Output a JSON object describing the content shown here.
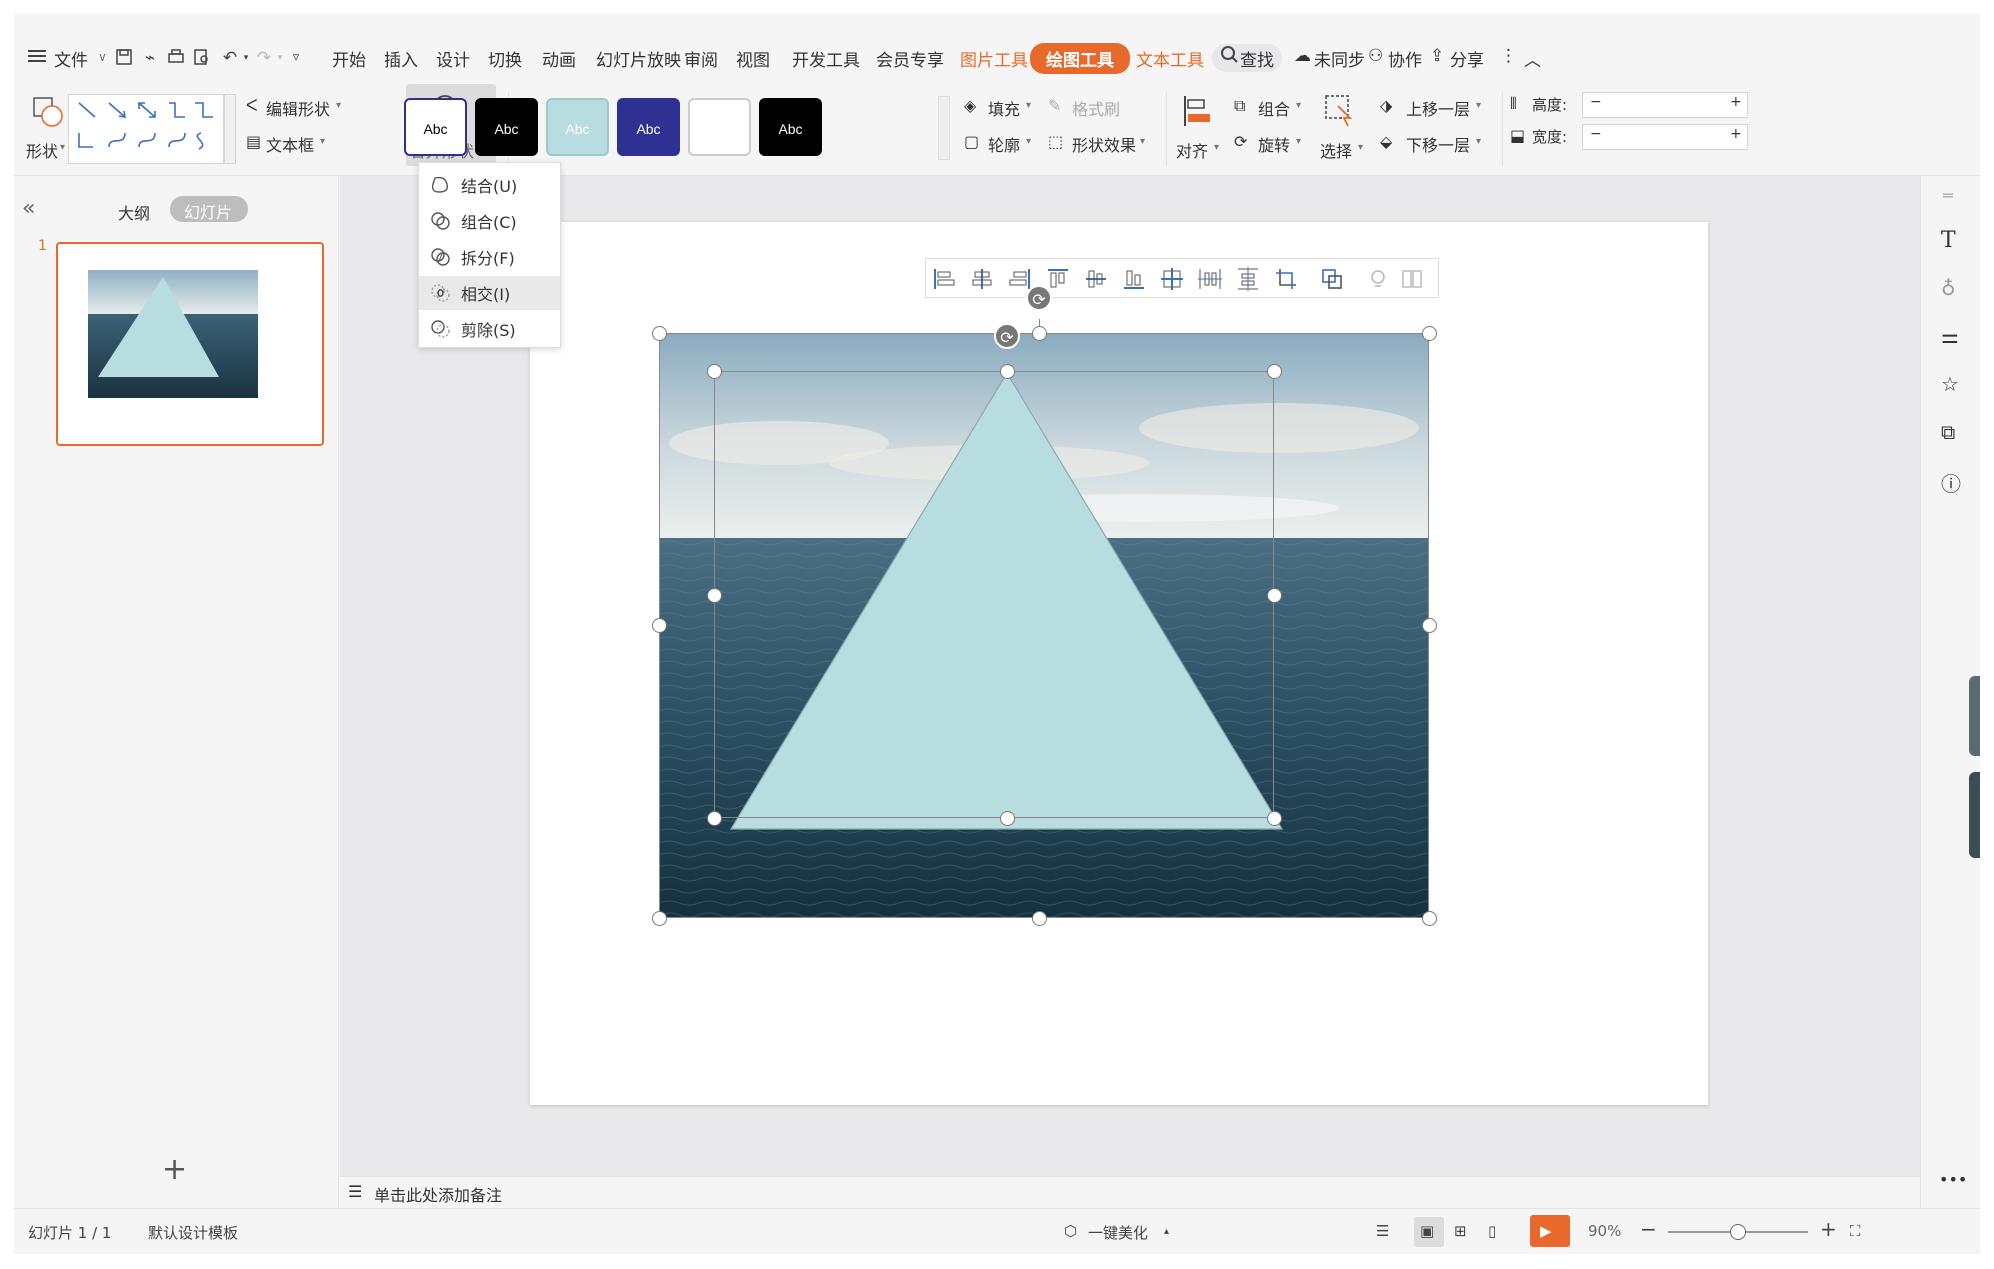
{
  "menubar": {
    "menu_label": "文件",
    "tabs": [
      "开始",
      "插入",
      "设计",
      "切换",
      "动画",
      "幻灯片放映",
      "审阅",
      "视图",
      "开发工具",
      "会员专享"
    ],
    "context_tabs": [
      "图片工具",
      "绘图工具",
      "文本工具"
    ],
    "active_context": "绘图工具",
    "search_label": "查找",
    "sync_label": "未同步",
    "collab_label": "协作",
    "share_label": "分享"
  },
  "ribbon": {
    "shape_label": "形状",
    "edit_shape_label": "编辑形状",
    "textbox_label": "文本框",
    "merge_shape_label": "合并形状",
    "style_samples": [
      {
        "text": "Abc",
        "bg": "#ffffff",
        "fg": "#000000",
        "border": "#2e3192"
      },
      {
        "text": "Abc",
        "bg": "#000000",
        "fg": "#ffffff",
        "border": "#000000"
      },
      {
        "text": "Abc",
        "bg": "#b8dde0",
        "fg": "#ffffff",
        "border": "#9cc9cd"
      },
      {
        "text": "Abc",
        "bg": "#2e3192",
        "fg": "#ffffff",
        "border": "#2e3192"
      },
      {
        "text": "",
        "bg": "#ffffff",
        "fg": "#000000",
        "border": "#cccccc"
      },
      {
        "text": "Abc",
        "bg": "#000000",
        "fg": "#ffffff",
        "border": "#000000"
      }
    ],
    "fill_label": "填充",
    "format_painter_label": "格式刷",
    "outline_label": "轮廓",
    "shape_effect_label": "形状效果",
    "align_label": "对齐",
    "group_label": "组合",
    "rotate_label": "旋转",
    "select_label": "选择",
    "bring_forward_label": "上移一层",
    "send_backward_label": "下移一层",
    "height_label": "高度:",
    "width_label": "宽度:",
    "minus": "−",
    "plus": "+"
  },
  "merge_menu": {
    "items": [
      {
        "label": "结合(U)",
        "icon": "union-icon"
      },
      {
        "label": "组合(C)",
        "icon": "combine-icon"
      },
      {
        "label": "拆分(F)",
        "icon": "fragment-icon"
      },
      {
        "label": "相交(I)",
        "icon": "intersect-icon",
        "highlighted": true
      },
      {
        "label": "剪除(S)",
        "icon": "subtract-icon"
      }
    ]
  },
  "leftpane": {
    "outline_tab": "大纲",
    "slides_tab": "幻灯片",
    "slide_number": "1",
    "add_slide": "+"
  },
  "notes_placeholder": "单击此处添加备注",
  "status": {
    "slide_info": "幻灯片 1 / 1",
    "template": "默认设计模板",
    "beautify": "一键美化",
    "zoom": "90%"
  },
  "colors": {
    "accent": "#e8692b",
    "triangle_fill": "#b8dde0",
    "selected_slide_border": "#e8692b"
  }
}
